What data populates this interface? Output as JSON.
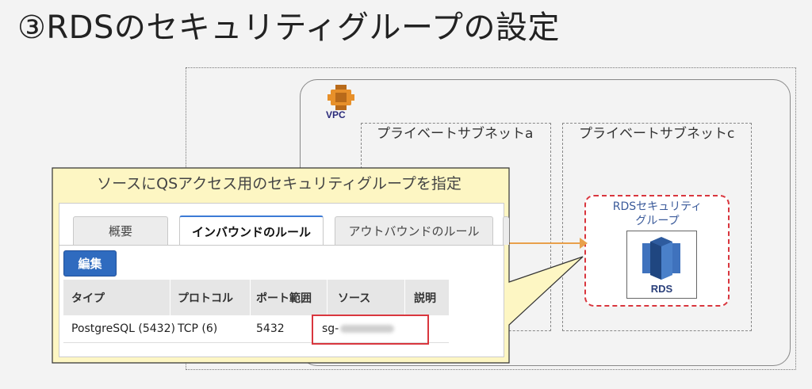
{
  "slide": {
    "title": "③RDSのセキュリティグループの設定"
  },
  "diagram": {
    "vpc_label": "VPC",
    "subnet_a_label": "プライベートサブネットa",
    "subnet_c_label": "プライベートサブネットc",
    "sg_label_line1": "RDSセキュリティ",
    "sg_label_line2": "グループ",
    "rds_label": "RDS",
    "colors": {
      "aws_orange": "#e7902a",
      "rds_blue": "#2e5b9e",
      "highlight_red": "#d9363e",
      "arrow": "#e8a04b"
    }
  },
  "callout": {
    "title": "ソースにQSアクセス用のセキュリティグループを指定",
    "tabs": [
      {
        "label": "概要"
      },
      {
        "label": "インバウンドのルール"
      },
      {
        "label": "アウトバウンドのルール"
      }
    ],
    "edit_button": "編集",
    "table": {
      "headers": [
        "タイプ",
        "プロトコル",
        "ポート範囲",
        "ソース",
        "説明"
      ],
      "rows": [
        {
          "type": "PostgreSQL (5432)",
          "protocol": "TCP (6)",
          "port": "5432",
          "source": "sg-",
          "description": ""
        }
      ]
    }
  }
}
